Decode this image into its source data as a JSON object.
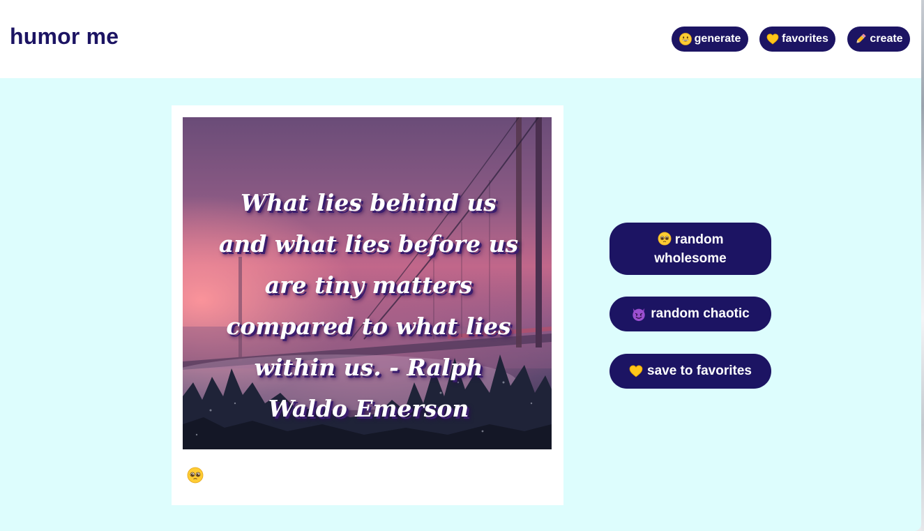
{
  "header": {
    "brand": "humor me",
    "nav": [
      {
        "icon": "grinning-face-icon",
        "label": "generate"
      },
      {
        "icon": "yellow-heart-icon",
        "label": "favorites"
      },
      {
        "icon": "pencil-icon",
        "label": "create"
      }
    ]
  },
  "meme": {
    "text": "What lies behind us and what lies before us are tiny matters compared to what lies within us. - Ralph Waldo Emerson",
    "background": "misty suspension bridge at dusk with pink sky"
  },
  "card": {
    "reaction_icon": "pleading-face-icon"
  },
  "actions": {
    "wholesome": {
      "icon": "pleading-face-icon",
      "label": "random wholesome"
    },
    "chaotic": {
      "icon": "smiling-devil-icon",
      "label": "random chaotic"
    },
    "save": {
      "icon": "yellow-heart-icon",
      "label": "save to favorites"
    }
  },
  "colors": {
    "accent": "#1c1463",
    "page_background": "#ddfdfd",
    "header_background": "#ffffff"
  }
}
